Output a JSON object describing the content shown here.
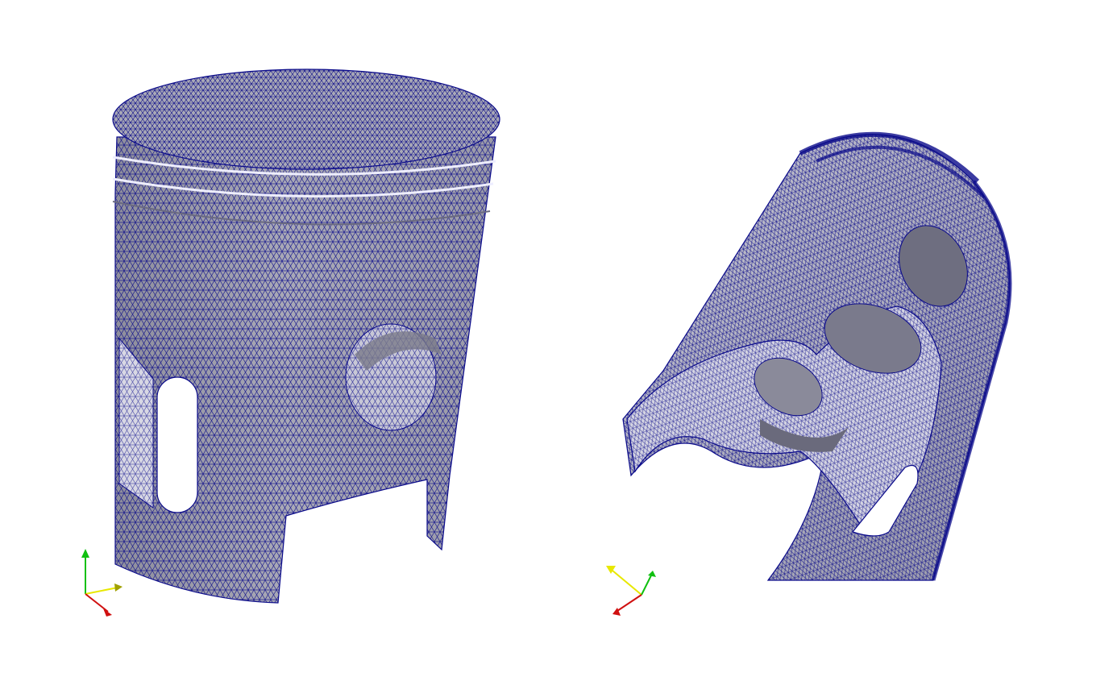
{
  "scene": {
    "background": "#ffffff",
    "surface_color": "#a9a9b6",
    "surface_shade": "#7f7f8d",
    "surface_light": "#d7d7e2",
    "wire_color": "#0a0a8a",
    "views": [
      {
        "name": "piston-exterior",
        "object": "piston-mesh",
        "orientation": "upright"
      },
      {
        "name": "piston-cutaway",
        "object": "piston-mesh",
        "orientation": "tilted-section"
      }
    ],
    "axes_colors": {
      "x": "#d01010",
      "y": "#10c010",
      "z": "#e8e800"
    }
  }
}
